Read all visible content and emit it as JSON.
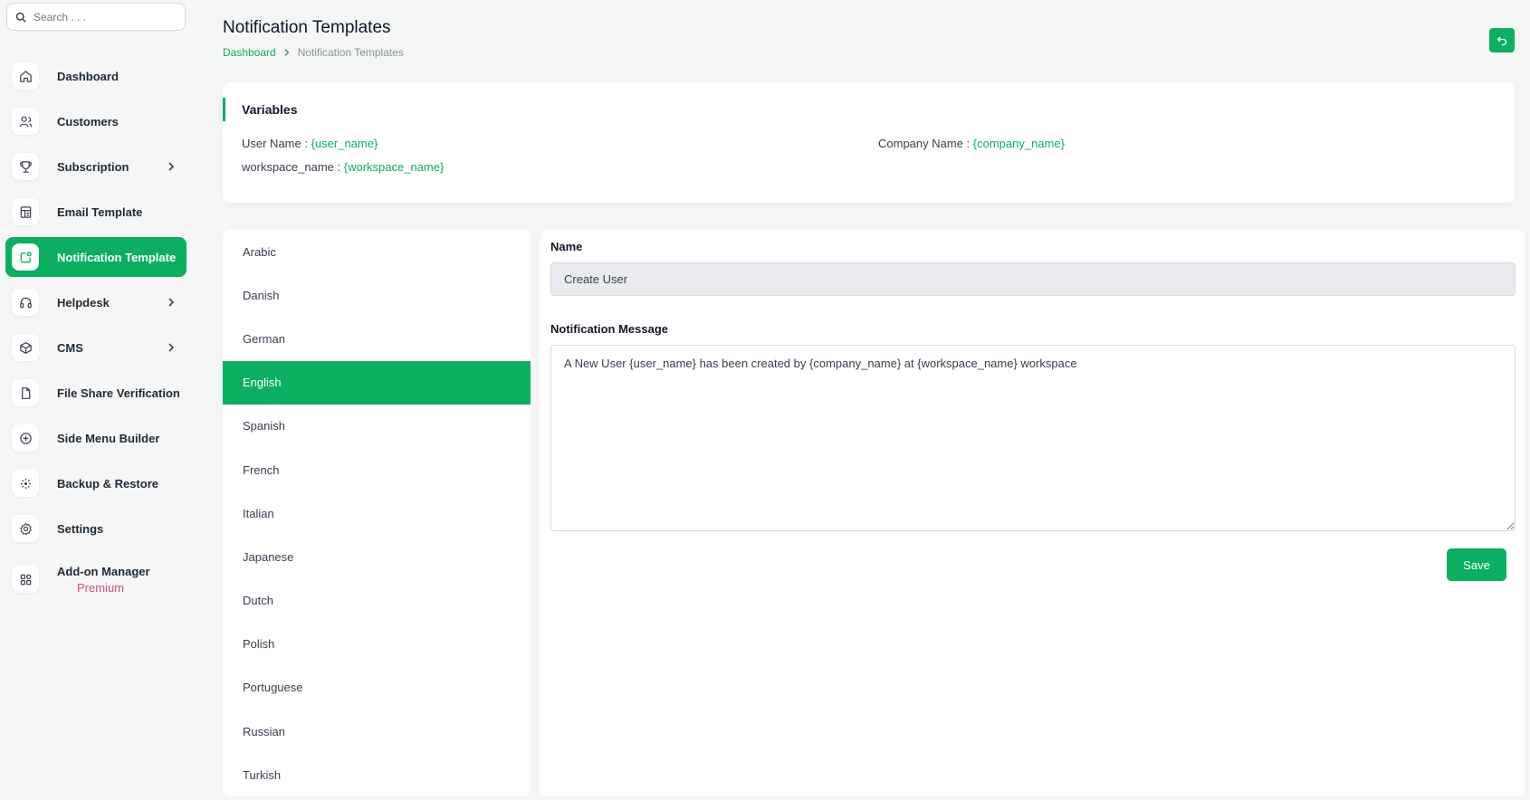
{
  "search": {
    "placeholder": "Search . . ."
  },
  "sidebar": {
    "items": [
      {
        "label": "Dashboard",
        "icon": "home-icon"
      },
      {
        "label": "Customers",
        "icon": "users-icon"
      },
      {
        "label": "Subscription",
        "icon": "trophy-icon",
        "has_submenu": true
      },
      {
        "label": "Email Template",
        "icon": "template-icon"
      },
      {
        "label": "Notification Template",
        "icon": "notification-icon",
        "active": true
      },
      {
        "label": "Helpdesk",
        "icon": "headset-icon",
        "has_submenu": true
      },
      {
        "label": "CMS",
        "icon": "cube-icon",
        "has_submenu": true
      },
      {
        "label": "File Share Verification",
        "icon": "file-icon"
      },
      {
        "label": "Side Menu Builder",
        "icon": "plus-circle-icon"
      },
      {
        "label": "Backup & Restore",
        "icon": "backup-icon"
      },
      {
        "label": "Settings",
        "icon": "gear-icon"
      },
      {
        "label": "Add-on Manager",
        "icon": "grid-icon",
        "badge": "Premium"
      }
    ]
  },
  "header": {
    "title": "Notification Templates",
    "breadcrumb": {
      "link": "Dashboard",
      "current": "Notification Templates"
    }
  },
  "variables": {
    "title": "Variables",
    "items": [
      {
        "label": "User Name : ",
        "value": "{user_name}"
      },
      {
        "label": "Company Name : ",
        "value": "{company_name}"
      },
      {
        "label": "workspace_name : ",
        "value": "{workspace_name}"
      }
    ]
  },
  "languages": {
    "items": [
      "Arabic",
      "Danish",
      "German",
      "English",
      "Spanish",
      "French",
      "Italian",
      "Japanese",
      "Dutch",
      "Polish",
      "Portuguese",
      "Russian",
      "Turkish"
    ],
    "active": "English"
  },
  "editor": {
    "name_label": "Name",
    "name_value": "Create User",
    "message_label": "Notification Message",
    "message_value": "A New User {user_name} has been created by {company_name} at {workspace_name} workspace",
    "save_label": "Save"
  },
  "colors": {
    "accent": "#0caf60",
    "premium": "#c54f8a"
  }
}
